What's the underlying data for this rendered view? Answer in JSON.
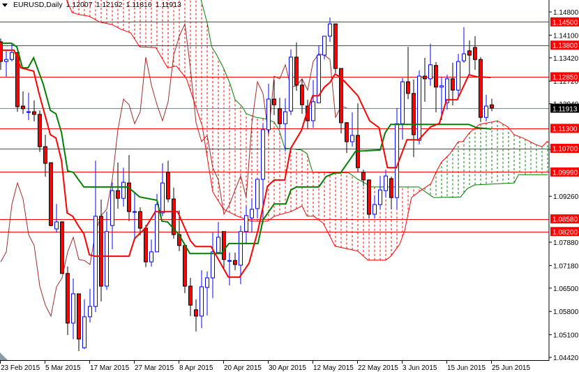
{
  "chart_data": {
    "type": "candlestick",
    "title": "EURUSD,Daily",
    "ohlc_header": [
      "1.12007",
      "1.12192",
      "1.11816",
      "1.11913"
    ],
    "ylim": [
      1.04337,
      1.15157
    ],
    "y_ticks": [
      "1.14800",
      "1.14100",
      "1.13420",
      "1.12720",
      "1.12040",
      "1.10670",
      "1.09260",
      "1.07880",
      "1.07180",
      "1.06500",
      "1.05800",
      "1.05100",
      "1.04420"
    ],
    "x_labels": [
      {
        "bar": 0,
        "label": "23 Feb 2015"
      },
      {
        "bar": 8,
        "label": "5 Mar 2015"
      },
      {
        "bar": 16,
        "label": "17 Mar 2015"
      },
      {
        "bar": 24,
        "label": "27 Mar 2015"
      },
      {
        "bar": 32,
        "label": "8 Apr 2015"
      },
      {
        "bar": 40,
        "label": "20 Apr 2015"
      },
      {
        "bar": 48,
        "label": "30 Apr 2015"
      },
      {
        "bar": 56,
        "label": "12 May 2015"
      },
      {
        "bar": 64,
        "label": "22 May 2015"
      },
      {
        "bar": 72,
        "label": "3 Jun 2015"
      },
      {
        "bar": 80,
        "label": "15 Jun 2015"
      },
      {
        "bar": 88,
        "label": "25 Jun 2015"
      }
    ],
    "candles_ohlc": [
      [
        1.139,
        1.14,
        1.1306,
        1.1331
      ],
      [
        1.1331,
        1.1363,
        1.1285,
        1.1337
      ],
      [
        1.1337,
        1.1383,
        1.1331,
        1.1358
      ],
      [
        1.1358,
        1.1358,
        1.118,
        1.1195
      ],
      [
        1.1197,
        1.1241,
        1.1174,
        1.1189
      ],
      [
        1.1178,
        1.1237,
        1.1155,
        1.118
      ],
      [
        1.118,
        1.1214,
        1.1151,
        1.1172
      ],
      [
        1.1172,
        1.1184,
        1.1059,
        1.1075
      ],
      [
        1.1075,
        1.1111,
        1.0985,
        1.1025
      ],
      [
        1.1027,
        1.1027,
        1.0836,
        1.0838
      ],
      [
        1.0828,
        1.0903,
        1.0817,
        1.0849
      ],
      [
        1.0849,
        1.0851,
        1.0693,
        1.0694
      ],
      [
        1.0694,
        1.0715,
        1.0509,
        1.0545
      ],
      [
        1.0545,
        1.0679,
        1.0497,
        1.0633
      ],
      [
        1.0633,
        1.0633,
        1.0461,
        1.0497
      ],
      [
        1.0471,
        1.0616,
        1.0467,
        1.0564
      ],
      [
        1.0564,
        1.0648,
        1.0547,
        1.0595
      ],
      [
        1.0595,
        1.1033,
        1.0578,
        1.0866
      ],
      [
        1.0866,
        1.0916,
        1.061,
        1.0656
      ],
      [
        1.0656,
        1.088,
        1.0645,
        1.082
      ],
      [
        1.0838,
        1.0968,
        1.0767,
        1.0943
      ],
      [
        1.0943,
        1.1027,
        1.0889,
        1.092
      ],
      [
        1.092,
        1.1012,
        1.0895,
        1.0968
      ],
      [
        1.0966,
        1.105,
        1.0851,
        1.088
      ],
      [
        1.088,
        1.0939,
        1.0799,
        1.088
      ],
      [
        1.088,
        1.0893,
        1.0809,
        1.083
      ],
      [
        1.083,
        1.084,
        1.0713,
        1.0729
      ],
      [
        1.0729,
        1.0796,
        1.0715,
        1.0759
      ],
      [
        1.0759,
        1.0933,
        1.0759,
        1.0901
      ],
      [
        1.0876,
        1.1025,
        1.0866,
        1.0966
      ],
      [
        1.0998,
        1.1033,
        1.0908,
        1.0918
      ],
      [
        1.0918,
        1.0952,
        1.0799,
        1.0811
      ],
      [
        1.0811,
        1.0884,
        1.0761,
        1.0778
      ],
      [
        1.0778,
        1.0778,
        1.0635,
        1.0656
      ],
      [
        1.0656,
        1.0681,
        1.0566,
        1.0599
      ],
      [
        1.0585,
        1.0616,
        1.052,
        1.0566
      ],
      [
        1.0566,
        1.0704,
        1.053,
        1.0654
      ],
      [
        1.0652,
        1.07,
        1.0568,
        1.0681
      ],
      [
        1.0681,
        1.0817,
        1.062,
        1.0759
      ],
      [
        1.0757,
        1.0849,
        1.0757,
        1.0803
      ],
      [
        1.082,
        1.082,
        1.0711,
        1.0736
      ],
      [
        1.0733,
        1.0757,
        1.0658,
        1.0733
      ],
      [
        1.0733,
        1.0757,
        1.0704,
        1.0721
      ],
      [
        1.0719,
        1.0838,
        1.0662,
        1.082
      ],
      [
        1.082,
        1.0897,
        1.0782,
        1.0868
      ],
      [
        1.0861,
        1.0918,
        1.0817,
        1.0887
      ],
      [
        1.0889,
        1.0977,
        1.0859,
        1.0977
      ],
      [
        1.0977,
        1.1144,
        1.0845,
        1.1126
      ],
      [
        1.1126,
        1.1264,
        1.1117,
        1.1218
      ],
      [
        1.1218,
        1.1275,
        1.117,
        1.1201
      ],
      [
        1.1189,
        1.1222,
        1.1128,
        1.1144
      ],
      [
        1.1144,
        1.122,
        1.1061,
        1.118
      ],
      [
        1.1182,
        1.1367,
        1.117,
        1.1344
      ],
      [
        1.1344,
        1.1388,
        1.1243,
        1.126
      ],
      [
        1.126,
        1.1279,
        1.1174,
        1.1201
      ],
      [
        1.1197,
        1.1216,
        1.1128,
        1.1153
      ],
      [
        1.1153,
        1.1275,
        1.1132,
        1.121
      ],
      [
        1.1207,
        1.1379,
        1.1207,
        1.135
      ],
      [
        1.135,
        1.1407,
        1.1337,
        1.1407
      ],
      [
        1.1407,
        1.1463,
        1.139,
        1.1444
      ],
      [
        1.1444,
        1.1444,
        1.1296,
        1.131
      ],
      [
        1.131,
        1.131,
        1.1115,
        1.1147
      ],
      [
        1.1147,
        1.1149,
        1.1056,
        1.109
      ],
      [
        1.109,
        1.1178,
        1.1075,
        1.1109
      ],
      [
        1.1109,
        1.1205,
        1.0998,
        1.1012
      ],
      [
        1.0998,
        1.1006,
        1.0956,
        1.0975
      ],
      [
        1.0975,
        1.0977,
        1.0859,
        1.0872
      ],
      [
        1.0872,
        1.0929,
        1.0859,
        1.0901
      ],
      [
        1.0901,
        1.0987,
        1.0887,
        1.0945
      ],
      [
        1.0943,
        1.1006,
        1.0922,
        1.0987
      ],
      [
        1.0979,
        1.0985,
        1.0887,
        1.0922
      ],
      [
        1.0922,
        1.1191,
        1.0887,
        1.1144
      ],
      [
        1.1144,
        1.1281,
        1.1096,
        1.127
      ],
      [
        1.127,
        1.1375,
        1.1218,
        1.1235
      ],
      [
        1.1235,
        1.1277,
        1.1044,
        1.1111
      ],
      [
        1.1094,
        1.1304,
        1.1082,
        1.1287
      ],
      [
        1.1287,
        1.1342,
        1.121,
        1.1279
      ],
      [
        1.1279,
        1.1384,
        1.1258,
        1.1321
      ],
      [
        1.1319,
        1.1329,
        1.1178,
        1.1254
      ],
      [
        1.1254,
        1.1285,
        1.1155,
        1.1258
      ],
      [
        1.1207,
        1.1291,
        1.1186,
        1.1279
      ],
      [
        1.1279,
        1.1327,
        1.1199,
        1.1245
      ],
      [
        1.1245,
        1.1354,
        1.1218,
        1.1331
      ],
      [
        1.1333,
        1.1434,
        1.1327,
        1.1354
      ],
      [
        1.1363,
        1.1394,
        1.1291,
        1.135
      ],
      [
        1.1373,
        1.1407,
        1.1306,
        1.1337
      ],
      [
        1.1337,
        1.1344,
        1.1149,
        1.1163
      ],
      [
        1.1163,
        1.1231,
        1.1151,
        1.1197
      ],
      [
        1.12007,
        1.12192,
        1.11816,
        1.11913
      ]
    ],
    "tenkan_sen": [
      [
        0,
        1.1365
      ],
      [
        2.4,
        1.1365
      ],
      [
        3.6,
        1.1312
      ],
      [
        5.9,
        1.1302
      ],
      [
        6.9,
        1.1233
      ],
      [
        8.9,
        1.1111
      ],
      [
        9.9,
        1.1101
      ],
      [
        10.9,
        1.1033
      ],
      [
        11.9,
        1.0876
      ],
      [
        12.9,
        1.0866
      ],
      [
        13.9,
        1.0838
      ],
      [
        14.9,
        1.0813
      ],
      [
        15.9,
        1.075
      ],
      [
        16.9,
        1.0746
      ],
      [
        23,
        1.0746
      ],
      [
        24,
        1.0799
      ],
      [
        25.9,
        1.083
      ],
      [
        27.7,
        1.088
      ],
      [
        31.7,
        1.088
      ],
      [
        34,
        1.0792
      ],
      [
        34.9,
        1.0775
      ],
      [
        37.7,
        1.0775
      ],
      [
        40.8,
        1.0683
      ],
      [
        42.8,
        1.0683
      ],
      [
        44.5,
        1.0725
      ],
      [
        46.1,
        1.0824
      ],
      [
        47.8,
        1.0956
      ],
      [
        49,
        1.0975
      ],
      [
        50.9,
        1.0975
      ],
      [
        52,
        1.1071
      ],
      [
        53.9,
        1.1124
      ],
      [
        54.9,
        1.118
      ],
      [
        55.9,
        1.1228
      ],
      [
        57,
        1.1228
      ],
      [
        58,
        1.1254
      ],
      [
        59,
        1.1268
      ],
      [
        59.9,
        1.1293
      ],
      [
        60.8,
        1.1285
      ],
      [
        62,
        1.1264
      ],
      [
        64,
        1.1228
      ],
      [
        66.1,
        1.1153
      ],
      [
        67.8,
        1.1132
      ],
      [
        69.3,
        1.1012
      ],
      [
        70.9,
        1.1012
      ],
      [
        72.8,
        1.1096
      ],
      [
        74.9,
        1.1096
      ],
      [
        77,
        1.1134
      ],
      [
        78.6,
        1.1145
      ],
      [
        79.9,
        1.1216
      ],
      [
        81.8,
        1.1216
      ],
      [
        83.9,
        1.1291
      ],
      [
        85.3,
        1.1285
      ],
      [
        87.8,
        1.1283
      ]
    ],
    "kijun_sen": [
      [
        0,
        1.1386
      ],
      [
        1.9,
        1.1386
      ],
      [
        2.9,
        1.1375
      ],
      [
        3.9,
        1.1312
      ],
      [
        4.9,
        1.1312
      ],
      [
        5.9,
        1.1342
      ],
      [
        7.6,
        1.1264
      ],
      [
        8.9,
        1.1184
      ],
      [
        9.9,
        1.1174
      ],
      [
        10.9,
        1.1117
      ],
      [
        12,
        1.1002
      ],
      [
        13,
        1.0998
      ],
      [
        14.9,
        1.0954
      ],
      [
        22.8,
        1.0954
      ],
      [
        24.9,
        1.0924
      ],
      [
        28,
        1.0914
      ],
      [
        28.9,
        1.0851
      ],
      [
        29.9,
        1.0849
      ],
      [
        32,
        1.0809
      ],
      [
        33.9,
        1.0754
      ],
      [
        39.5,
        1.0754
      ],
      [
        40.9,
        1.0784
      ],
      [
        46.1,
        1.0784
      ],
      [
        47,
        1.0855
      ],
      [
        49,
        1.0903
      ],
      [
        51.1,
        1.0903
      ],
      [
        52,
        1.0945
      ],
      [
        53,
        1.0954
      ],
      [
        57,
        1.0954
      ],
      [
        58.3,
        1.0985
      ],
      [
        59.9,
        1.0996
      ],
      [
        60.9,
        1.0996
      ],
      [
        63.6,
        1.1061
      ],
      [
        68,
        1.1065
      ],
      [
        68.9,
        1.1117
      ],
      [
        69.9,
        1.1142
      ],
      [
        83.9,
        1.1142
      ],
      [
        85.3,
        1.1132
      ],
      [
        87.9,
        1.1128
      ]
    ],
    "senkou_span_a": [
      [
        11.8,
        1.1516
      ],
      [
        12.8,
        1.1478
      ],
      [
        14,
        1.1472
      ],
      [
        15.8,
        1.1467
      ],
      [
        17.8,
        1.1449
      ],
      [
        19.9,
        1.1442
      ],
      [
        21.5,
        1.1428
      ],
      [
        23.3,
        1.1417
      ],
      [
        24.9,
        1.1375
      ],
      [
        27.8,
        1.1373
      ],
      [
        29.9,
        1.1312
      ],
      [
        31.5,
        1.1317
      ],
      [
        33.3,
        1.1279
      ],
      [
        36.1,
        1.1138
      ],
      [
        38,
        1.0939
      ],
      [
        39.9,
        1.0887
      ],
      [
        42.4,
        1.0866
      ],
      [
        44.9,
        1.0851
      ],
      [
        47.8,
        1.0851
      ],
      [
        49,
        1.0866
      ],
      [
        52,
        1.088
      ],
      [
        54,
        1.0897
      ],
      [
        54.9,
        1.0866
      ],
      [
        56.1,
        1.0866
      ],
      [
        57.8,
        1.0845
      ],
      [
        59.9,
        1.0776
      ],
      [
        63,
        1.0765
      ],
      [
        64,
        1.0761
      ],
      [
        65.8,
        1.0734
      ],
      [
        69,
        1.0734
      ],
      [
        69.9,
        1.0746
      ],
      [
        71.5,
        1.0782
      ],
      [
        72.4,
        1.0824
      ],
      [
        73.6,
        1.0922
      ],
      [
        74.9,
        1.0939
      ],
      [
        77.1,
        1.0964
      ],
      [
        78,
        1.0998
      ],
      [
        79,
        1.1029
      ],
      [
        80.5,
        1.1054
      ],
      [
        82,
        1.109
      ],
      [
        82.8,
        1.109
      ],
      [
        84,
        1.1117
      ],
      [
        85.8,
        1.1142
      ],
      [
        88,
        1.1149
      ],
      [
        89,
        1.1153
      ],
      [
        90.9,
        1.1134
      ],
      [
        92,
        1.1111
      ],
      [
        93.6,
        1.1101
      ],
      [
        95.8,
        1.1082
      ],
      [
        97,
        1.1075
      ],
      [
        98,
        1.1092
      ]
    ],
    "senkou_span_b": [
      [
        11.8,
        1.162
      ],
      [
        24,
        1.158
      ],
      [
        35.9,
        1.1516
      ],
      [
        37,
        1.1447
      ],
      [
        37.8,
        1.1375
      ],
      [
        38.6,
        1.1354
      ],
      [
        39.9,
        1.1312
      ],
      [
        41.1,
        1.1264
      ],
      [
        42,
        1.1216
      ],
      [
        43.3,
        1.1195
      ],
      [
        44,
        1.1174
      ],
      [
        45.8,
        1.1163
      ],
      [
        47.4,
        1.1159
      ],
      [
        49,
        1.1149
      ],
      [
        49.9,
        1.1124
      ],
      [
        50.9,
        1.1071
      ],
      [
        53.9,
        1.1065
      ],
      [
        54.9,
        1.1054
      ],
      [
        55.9,
        1.0998
      ],
      [
        62.4,
        1.0996
      ],
      [
        64,
        1.0977
      ],
      [
        66.5,
        1.0954
      ],
      [
        74.9,
        1.0954
      ],
      [
        75.8,
        1.0943
      ],
      [
        77,
        1.0929
      ],
      [
        77.6,
        1.0922
      ],
      [
        82.4,
        1.0924
      ],
      [
        83.6,
        1.0949
      ],
      [
        84.9,
        1.096
      ],
      [
        92,
        1.0966
      ],
      [
        92.8,
        1.0991
      ],
      [
        98,
        1.0991
      ]
    ],
    "chikou_shift_bars": 26,
    "levels": [
      "1.14500",
      "1.13800",
      "1.12850",
      "1.11300",
      "1.10700",
      "1.09990",
      "1.08580",
      "1.08200"
    ],
    "current_price": "1.11913",
    "colors": {
      "bull": "#0000ff",
      "bear_fill": "#ff0000",
      "bear_outline": "#000000",
      "tenkan": "#ff0000",
      "kijun": "#008000",
      "chikou": "#a52a2a",
      "cloud_bear": "#ff0000",
      "cloud_bull": "#008000",
      "level": "#ff0000",
      "current": "#778899",
      "current_label": "#000000"
    }
  }
}
